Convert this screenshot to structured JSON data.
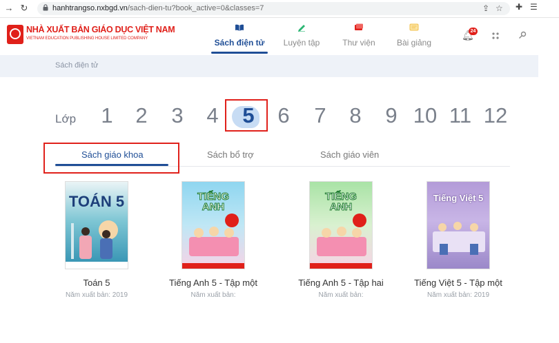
{
  "browser": {
    "back": "→",
    "reload": "↻",
    "host": "hanhtrangso.nxbgd.vn",
    "path": "/sach-dien-tu?book_active=0&classes=7"
  },
  "header": {
    "logo_title": "NHÀ XUẤT BẢN GIÁO DỤC VIỆT NAM",
    "logo_subtitle": "VIETNAM EDUCATION PUBLISHING HOUSE LIMITED COMPANY",
    "tabs": [
      {
        "label": "Sách điện tử",
        "icon": "book-open-icon",
        "color": "#1f4e96"
      },
      {
        "label": "Luyện tập",
        "icon": "pencil-icon",
        "color": "#2bb673"
      },
      {
        "label": "Thư viện",
        "icon": "library-icon",
        "color": "#e0201a"
      },
      {
        "label": "Bài giảng",
        "icon": "slides-icon",
        "color": "#f3c14a"
      }
    ],
    "notification_count": "24"
  },
  "breadcrumb": "Sách điện tử",
  "grades": {
    "label": "Lớp",
    "items": [
      "1",
      "2",
      "3",
      "4",
      "5",
      "6",
      "7",
      "8",
      "9",
      "10",
      "11",
      "12"
    ],
    "selected": "5"
  },
  "sub_tabs": [
    "Sách giáo khoa",
    "Sách bổ trợ",
    "Sách giáo viên"
  ],
  "books": [
    {
      "title": "Toán 5",
      "year": "Năm xuất bản: 2019",
      "cover_text": "TOÁN 5"
    },
    {
      "title": "Tiếng Anh 5 - Tập một",
      "year": "Năm xuất bản:",
      "cover_text": "TIẾNG ANH"
    },
    {
      "title": "Tiếng Anh 5 - Tập hai",
      "year": "Năm xuất bản:",
      "cover_text": "TIẾNG ANH"
    },
    {
      "title": "Tiếng Việt 5 - Tập một",
      "year": "Năm xuất bản: 2019",
      "cover_text": "Tiếng Việt 5"
    }
  ],
  "colors": {
    "brand_red": "#e0201a",
    "brand_blue": "#1f4e96"
  }
}
